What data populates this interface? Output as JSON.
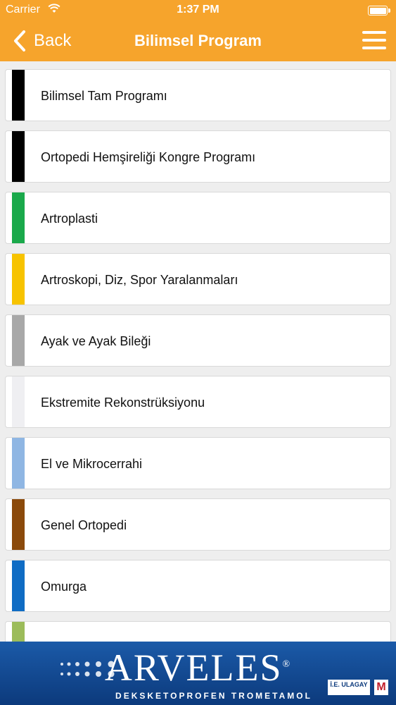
{
  "status_bar": {
    "carrier": "Carrier",
    "time": "1:37 PM"
  },
  "nav": {
    "back_label": "Back",
    "title": "Bilimsel Program"
  },
  "items": [
    {
      "label": "Bilimsel Tam Programı",
      "color": "#000000"
    },
    {
      "label": "Ortopedi Hemşireliği Kongre Programı",
      "color": "#000000"
    },
    {
      "label": "Artroplasti",
      "color": "#1aa94b"
    },
    {
      "label": "Artroskopi, Diz, Spor Yaralanmaları",
      "color": "#f7c300"
    },
    {
      "label": "Ayak ve Ayak Bileği",
      "color": "#a8a8a8"
    },
    {
      "label": "Ekstremite Rekonstrüksiyonu",
      "color": "#efeff2"
    },
    {
      "label": "El ve Mikrocerrahi",
      "color": "#8fb6e3"
    },
    {
      "label": "Genel Ortopedi",
      "color": "#8b4a0b"
    },
    {
      "label": "Omurga",
      "color": "#0f6cc4"
    },
    {
      "label": "",
      "color": "#9cbc5a"
    }
  ],
  "banner": {
    "brand": "ARVELES",
    "registered": "®",
    "subtitle": "DEKSKETOPROFEN TROMETAMOL",
    "company": "İ.E. ULAGAY",
    "logo_letter": "M"
  }
}
